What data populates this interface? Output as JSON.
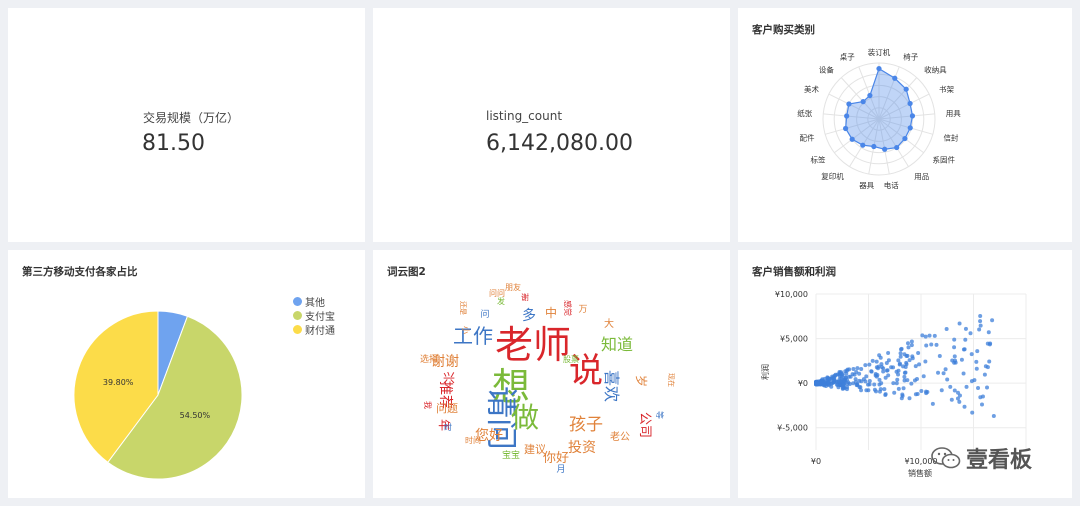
{
  "kpi1": {
    "label": "交易规模（万亿）",
    "value": "81.50"
  },
  "kpi2": {
    "label": "listing_count",
    "value": "6,142,080.00"
  },
  "radar": {
    "title": "客户购买类别",
    "categories": [
      "装订机",
      "椅子",
      "收纳具",
      "书架",
      "用具",
      "信封",
      "系固件",
      "用品",
      "电话",
      "器具",
      "复印机",
      "标签",
      "配件",
      "纸张",
      "美术",
      "设备",
      "桌子"
    ],
    "values": [
      0.9,
      0.78,
      0.72,
      0.62,
      0.6,
      0.58,
      0.58,
      0.6,
      0.55,
      0.5,
      0.55,
      0.6,
      0.62,
      0.58,
      0.6,
      0.42,
      0.45
    ],
    "color": "#4a86e8"
  },
  "pie": {
    "title": "第三方移动支付各家占比",
    "labels": [
      "其他",
      "支付宝",
      "财付通"
    ],
    "values": [
      5.7,
      54.5,
      39.8
    ],
    "value_labels": [
      "",
      "54.50%",
      "39.80%"
    ],
    "colors": [
      "#6fa3ef",
      "#c8d66a",
      "#fcdc49"
    ]
  },
  "wordcloud": {
    "title": "词云图2",
    "words": [
      {
        "text": "老师",
        "color": "#d9262b"
      },
      {
        "text": "想",
        "color": "#7bba3a"
      },
      {
        "text": "说",
        "color": "#d9262b"
      },
      {
        "text": "请问",
        "color": "#3d76c5"
      },
      {
        "text": "做",
        "color": "#7bba3a"
      },
      {
        "text": "工作",
        "color": "#3d76c5"
      },
      {
        "text": "知道",
        "color": "#7bba3a"
      },
      {
        "text": "孩子",
        "color": "#e0823a"
      },
      {
        "text": "喜欢",
        "color": "#3d76c5"
      },
      {
        "text": "谢谢",
        "color": "#e0823a"
      },
      {
        "text": "你好",
        "color": "#e0823a"
      },
      {
        "text": "投资",
        "color": "#e0823a"
      },
      {
        "text": "您好",
        "color": "#e0823a"
      },
      {
        "text": "多",
        "color": "#3d76c5"
      },
      {
        "text": "中",
        "color": "#e0823a"
      },
      {
        "text": "岁",
        "color": "#e0823a"
      },
      {
        "text": "公司",
        "color": "#d9262b"
      },
      {
        "text": "推荐",
        "color": "#d9262b"
      },
      {
        "text": "问题",
        "color": "#e0823a"
      },
      {
        "text": "兴",
        "color": "#d9262b"
      },
      {
        "text": "年",
        "color": "#d9262b"
      },
      {
        "text": "月",
        "color": "#3d76c5"
      },
      {
        "text": "宝宝",
        "color": "#7bba3a"
      },
      {
        "text": "建议",
        "color": "#e0823a"
      },
      {
        "text": "大",
        "color": "#e0823a"
      },
      {
        "text": "选择",
        "color": "#e0823a"
      },
      {
        "text": "时间",
        "color": "#e0823a"
      },
      {
        "text": "老公",
        "color": "#e0823a"
      },
      {
        "text": "问",
        "color": "#3d76c5"
      },
      {
        "text": "发",
        "color": "#7bba3a"
      },
      {
        "text": "万",
        "color": "#e0823a"
      },
      {
        "text": "时",
        "color": "#3d76c5"
      },
      {
        "text": "我",
        "color": "#d9262b"
      },
      {
        "text": "谢",
        "color": "#d9262b"
      },
      {
        "text": "股票",
        "color": "#7bba3a"
      },
      {
        "text": "现在",
        "color": "#e0823a"
      },
      {
        "text": "小",
        "color": "#e0823a"
      },
      {
        "text": "等",
        "color": "#3d76c5"
      },
      {
        "text": "感觉",
        "color": "#d9262b"
      },
      {
        "text": "还是",
        "color": "#e0823a"
      },
      {
        "text": "问问",
        "color": "#e0823a"
      },
      {
        "text": "朋友",
        "color": "#e0823a"
      },
      {
        "text": "现金",
        "color": "#7bba3a"
      }
    ]
  },
  "scatter": {
    "title": "客户销售额和利润",
    "y_ticks": [
      "¥10,000",
      "¥5,000",
      "¥0",
      "¥-5,000"
    ],
    "x_ticks": [
      "¥0",
      "¥10,000"
    ],
    "xlabel": "销售额",
    "ylabel": "利润",
    "color": "#3d7fd9"
  },
  "watermark": {
    "text": "壹看板"
  }
}
